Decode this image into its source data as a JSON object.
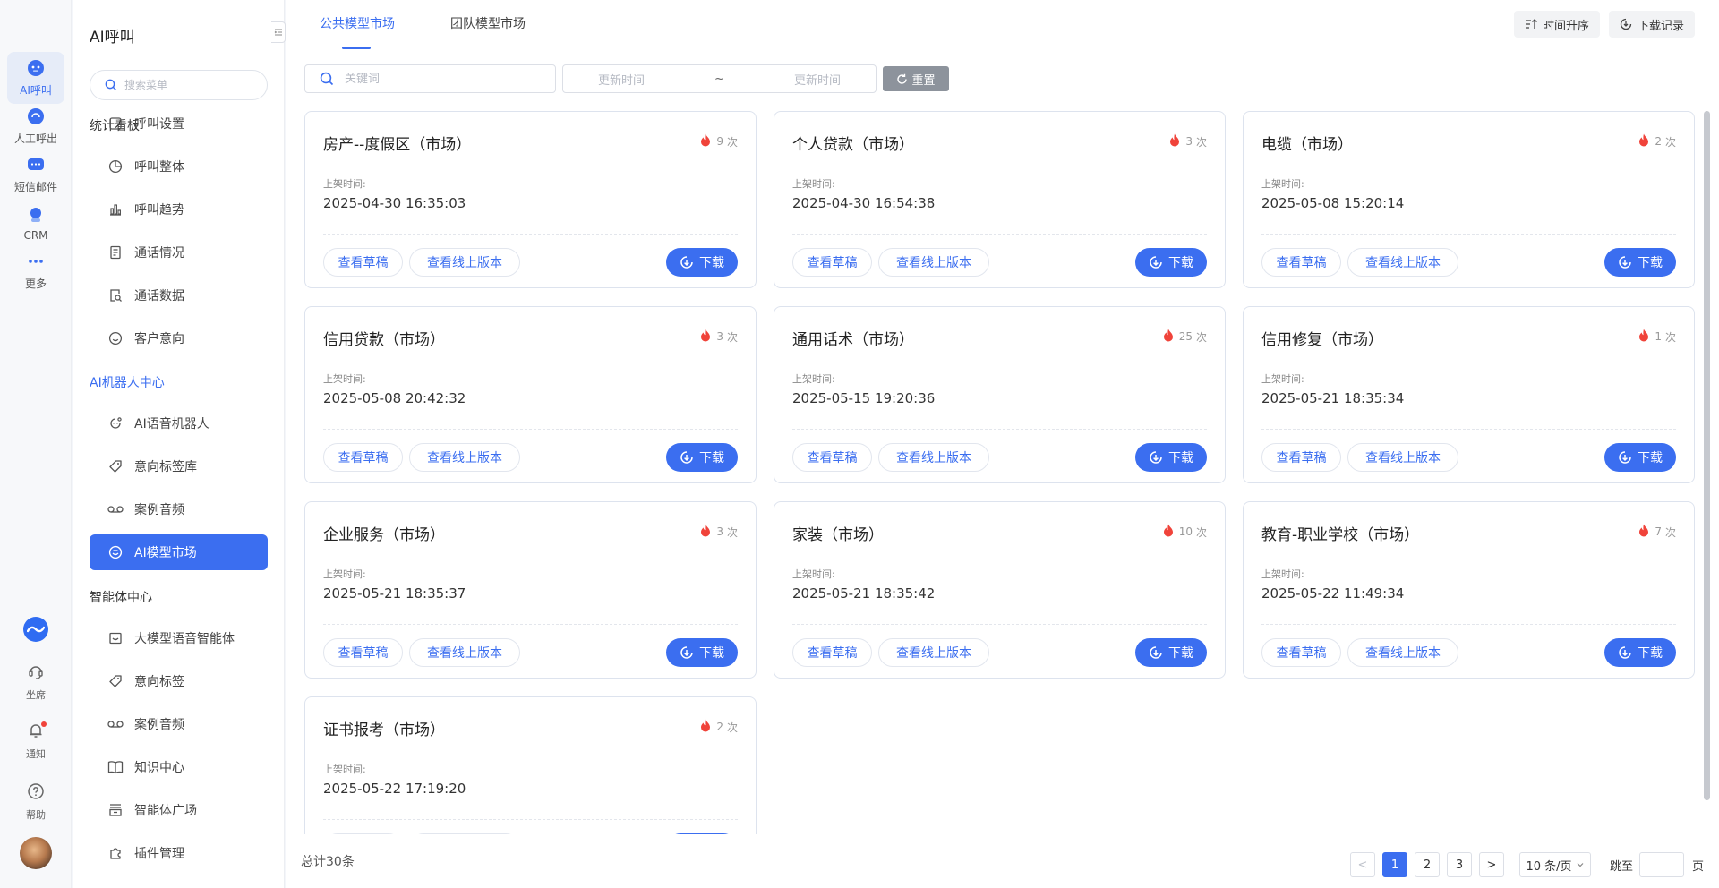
{
  "rail": {
    "items": [
      {
        "label": "AI呼叫",
        "icon": "robot-icon",
        "active": true
      },
      {
        "label": "人工呼出",
        "icon": "headset-icon",
        "active": false
      },
      {
        "label": "短信邮件",
        "icon": "message-icon",
        "active": false
      },
      {
        "label": "CRM",
        "icon": "crm-icon",
        "active": false
      },
      {
        "label": "更多",
        "icon": "more-icon",
        "active": false
      }
    ],
    "bottom": [
      {
        "label": "坐席",
        "icon": "seat-icon"
      },
      {
        "label": "通知",
        "icon": "bell-icon"
      },
      {
        "label": "帮助",
        "icon": "help-icon"
      }
    ]
  },
  "menu": {
    "title": "AI呼叫",
    "search_placeholder": "搜索菜单",
    "overlap_group": "统计看板",
    "overlap_item": "呼叫设置",
    "items": [
      {
        "label": "呼叫整体",
        "icon": "pie-chart-icon"
      },
      {
        "label": "呼叫趋势",
        "icon": "bar-chart-icon"
      },
      {
        "label": "通话情况",
        "icon": "document-icon"
      },
      {
        "label": "通话数据",
        "icon": "data-search-icon"
      },
      {
        "label": "客户意向",
        "icon": "smile-icon"
      }
    ],
    "group_ai": "AI机器人中心",
    "ai_items": [
      {
        "label": "AI语音机器人",
        "icon": "voice-robot-icon"
      },
      {
        "label": "意向标签库",
        "icon": "tag-icon"
      },
      {
        "label": "案例音频",
        "icon": "audio-icon"
      },
      {
        "label": "AI模型市场",
        "icon": "market-icon",
        "active": true
      }
    ],
    "group_agent": "智能体中心",
    "agent_items": [
      {
        "label": "大模型语音智能体",
        "icon": "chat-icon"
      },
      {
        "label": "意向标签",
        "icon": "tag-icon"
      },
      {
        "label": "案例音频",
        "icon": "audio-icon"
      },
      {
        "label": "知识中心",
        "icon": "book-icon"
      },
      {
        "label": "智能体广场",
        "icon": "store-icon"
      },
      {
        "label": "插件管理",
        "icon": "plugin-icon"
      }
    ]
  },
  "tabs": [
    {
      "label": "公共模型市场",
      "active": true
    },
    {
      "label": "团队模型市场",
      "active": false
    }
  ],
  "toolbar": {
    "sort_label": "时间升序",
    "download_records_label": "下载记录"
  },
  "filters": {
    "keyword_placeholder": "关键词",
    "date_start_placeholder": "更新时间",
    "date_sep": "~",
    "date_end_placeholder": "更新时间",
    "reset_label": "重置"
  },
  "card_labels": {
    "listed_label": "上架时间:",
    "draft_label": "查看草稿",
    "online_label": "查看线上版本",
    "download_label": "下载",
    "count_suffix": "次"
  },
  "cards": [
    {
      "title": "房产--度假区（市场）",
      "count": "9",
      "time": "2025-04-30 16:35:03"
    },
    {
      "title": "个人贷款（市场）",
      "count": "3",
      "time": "2025-04-30 16:54:38"
    },
    {
      "title": "电缆（市场）",
      "count": "2",
      "time": "2025-05-08 15:20:14"
    },
    {
      "title": "信用贷款（市场）",
      "count": "3",
      "time": "2025-05-08 20:42:32"
    },
    {
      "title": "通用话术（市场）",
      "count": "25",
      "time": "2025-05-15 19:20:36"
    },
    {
      "title": "信用修复（市场）",
      "count": "1",
      "time": "2025-05-21 18:35:34"
    },
    {
      "title": "企业服务（市场）",
      "count": "3",
      "time": "2025-05-21 18:35:37"
    },
    {
      "title": "家装（市场）",
      "count": "10",
      "time": "2025-05-21 18:35:42"
    },
    {
      "title": "教育-职业学校（市场）",
      "count": "7",
      "time": "2025-05-22 11:49:34"
    },
    {
      "title": "证书报考（市场）",
      "count": "2",
      "time": "2025-05-22 17:19:20"
    }
  ],
  "pagination": {
    "total_text": "总计30条",
    "prev": "<",
    "pages": [
      "1",
      "2",
      "3"
    ],
    "current": "1",
    "next": ">",
    "page_size": "10 条/页",
    "goto_label": "跳至",
    "goto_suffix": "页"
  },
  "colors": {
    "accent": "#3b6ef0",
    "flame": "#f0433a",
    "notify_dot": "#f0433a"
  }
}
